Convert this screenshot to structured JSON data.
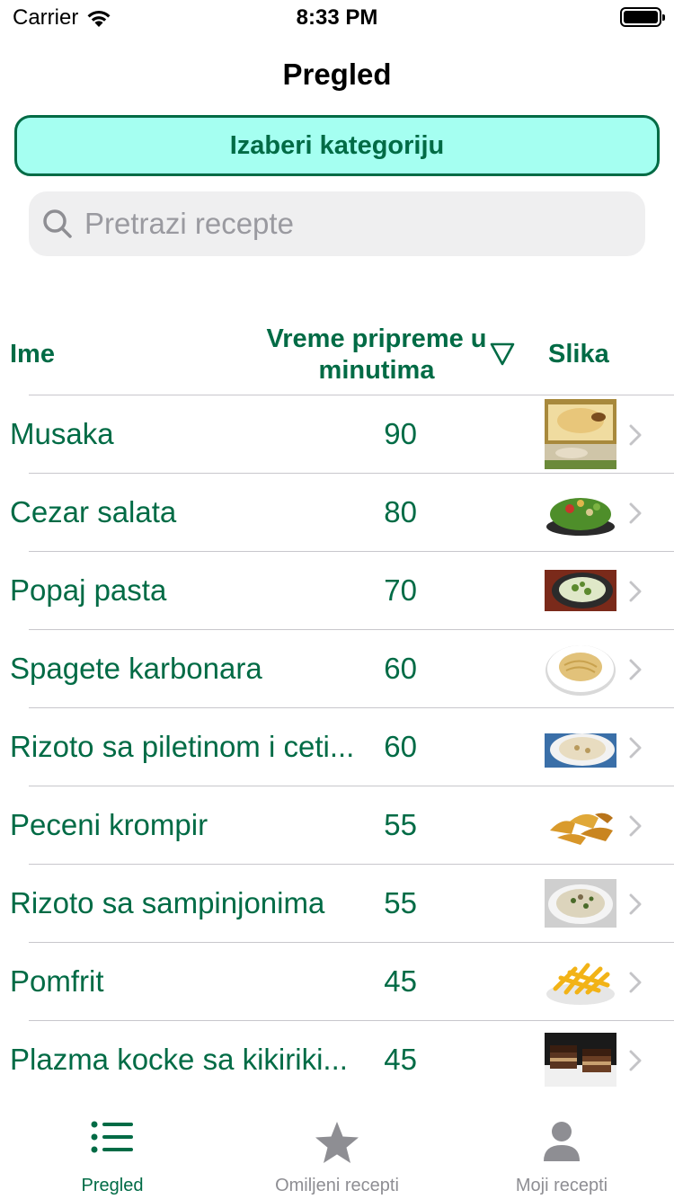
{
  "status_bar": {
    "carrier": "Carrier",
    "time": "8:33 PM"
  },
  "nav": {
    "title": "Pregled"
  },
  "category_button": {
    "label": "Izaberi kategoriju"
  },
  "search": {
    "placeholder": "Pretrazi recepte"
  },
  "table": {
    "headers": {
      "name": "Ime",
      "time": "Vreme pripreme u minutima",
      "image": "Slika"
    },
    "rows": [
      {
        "name": "Musaka",
        "minutes": "90",
        "image": "musaka-photo"
      },
      {
        "name": "Cezar salata",
        "minutes": "80",
        "image": "salad-photo"
      },
      {
        "name": "Popaj pasta",
        "minutes": "70",
        "image": "pasta-photo"
      },
      {
        "name": "Spagete karbonara",
        "minutes": "60",
        "image": "spaghetti-photo"
      },
      {
        "name": "Rizoto sa piletinom i ceti...",
        "minutes": "60",
        "image": "risotto-photo"
      },
      {
        "name": "Peceni krompir",
        "minutes": "55",
        "image": "potato-photo"
      },
      {
        "name": "Rizoto sa sampinjonima",
        "minutes": "55",
        "image": "mushroom-risotto-photo"
      },
      {
        "name": "Pomfrit",
        "minutes": "45",
        "image": "fries-photo"
      },
      {
        "name": "Plazma kocke sa kikiriki...",
        "minutes": "45",
        "image": "cake-photo"
      }
    ]
  },
  "tabs": [
    {
      "label": "Pregled",
      "icon": "list-icon",
      "active": true
    },
    {
      "label": "Omiljeni recepti",
      "icon": "star-icon",
      "active": false
    },
    {
      "label": "Moji recepti",
      "icon": "person-icon",
      "active": false
    }
  ],
  "colors": {
    "accent": "#006b45",
    "button_bg": "#a5fff1",
    "inactive": "#8e8e93"
  }
}
